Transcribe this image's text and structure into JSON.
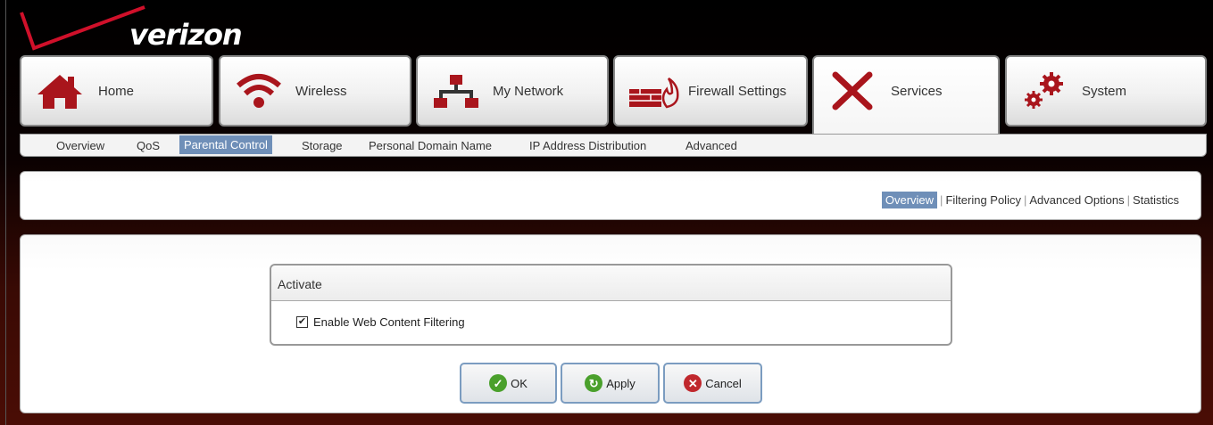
{
  "brand": {
    "name": "verizon"
  },
  "tabs": [
    {
      "label": "Home",
      "icon": "home-icon"
    },
    {
      "label": "Wireless",
      "icon": "wireless-icon"
    },
    {
      "label": "My Network",
      "icon": "network-icon"
    },
    {
      "label": "Firewall Settings",
      "icon": "firewall-icon"
    },
    {
      "label": "Services",
      "icon": "tools-icon",
      "active": true
    },
    {
      "label": "System",
      "icon": "gears-icon"
    }
  ],
  "subnav": [
    {
      "label": "Overview"
    },
    {
      "label": "QoS"
    },
    {
      "label": "Parental Control",
      "active": true
    },
    {
      "label": "Storage"
    },
    {
      "label": "Personal Domain Name"
    },
    {
      "label": "IP Address Distribution"
    },
    {
      "label": "Advanced"
    }
  ],
  "sublinks": [
    {
      "label": "Overview",
      "active": true
    },
    {
      "label": "Filtering Policy"
    },
    {
      "label": "Advanced Options"
    },
    {
      "label": "Statistics"
    }
  ],
  "activate": {
    "title": "Activate",
    "checkbox_label": "Enable Web Content Filtering",
    "checked": true
  },
  "buttons": {
    "ok": "OK",
    "apply": "Apply",
    "cancel": "Cancel"
  },
  "colors": {
    "brand_red": "#c8102e",
    "accent_blue": "#6f8fb8",
    "ok_green": "#4aa02c",
    "cancel_red": "#c0282d"
  }
}
